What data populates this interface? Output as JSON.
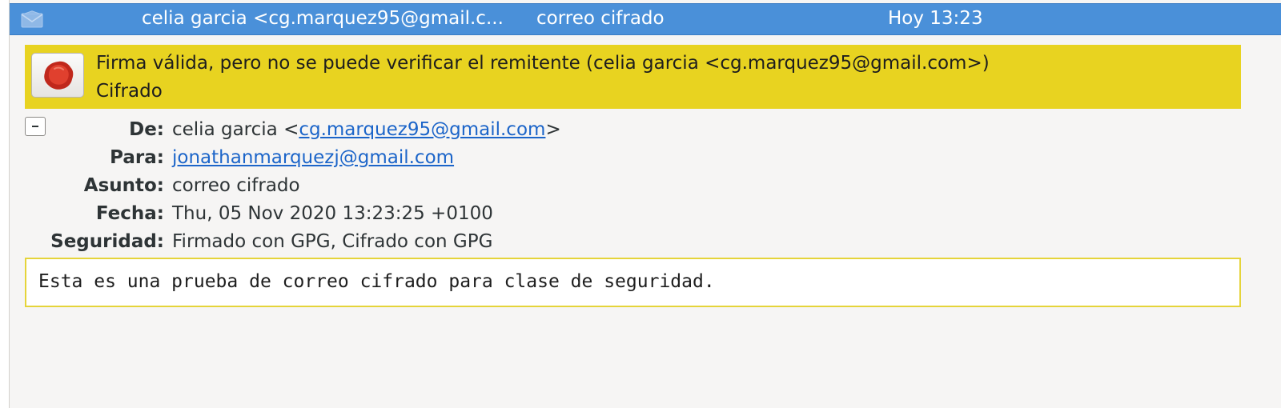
{
  "message_list": {
    "selected_row": {
      "from": "celia garcia <cg.marquez95@gmail.c...",
      "subject": "correo cifrado",
      "date": "Hoy 13:23",
      "icon": "envelope-icon"
    }
  },
  "signature_banner": {
    "icon": "wax-seal-icon",
    "status_line": "Firma válida, pero no se puede verificar el remitente (celia garcia <cg.marquez95@gmail.com>)",
    "encryption_line": "Cifrado",
    "color": "#e8d320"
  },
  "headers": {
    "from": {
      "label": "De:",
      "name_prefix": "celia garcia <",
      "email": "cg.marquez95@gmail.com",
      "suffix": ">"
    },
    "to": {
      "label": "Para:",
      "email": "jonathanmarquezj@gmail.com"
    },
    "subject": {
      "label": "Asunto:",
      "value": "correo cifrado"
    },
    "date": {
      "label": "Fecha:",
      "value": "Thu, 05 Nov 2020 13:23:25 +0100"
    },
    "security": {
      "label": "Seguridad:",
      "value": "Firmado con GPG, Cifrado con GPG"
    }
  },
  "body": {
    "text": "Esta es una prueba de correo cifrado para clase de seguridad."
  },
  "colors": {
    "selection": "#4a90d9",
    "link": "#1c65c9",
    "banner": "#e8d320"
  }
}
